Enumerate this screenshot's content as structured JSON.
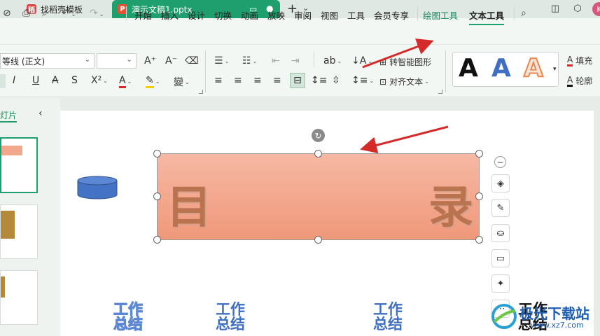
{
  "tabs": [
    {
      "label": "找稻壳模板",
      "icon": "docer-icon"
    },
    {
      "label": "演示文稿1.pptx",
      "icon": "ppt-icon"
    }
  ],
  "tab_controls": {
    "add": "+",
    "menu": "⌄"
  },
  "quick_access": [
    "folder-open",
    "print",
    "print-preview",
    "undo",
    "redo"
  ],
  "menus": [
    {
      "label": "开始"
    },
    {
      "label": "插入"
    },
    {
      "label": "设计"
    },
    {
      "label": "切换"
    },
    {
      "label": "动画"
    },
    {
      "label": "放映"
    },
    {
      "label": "审阅"
    },
    {
      "label": "视图"
    },
    {
      "label": "工具"
    },
    {
      "label": "会员专享"
    },
    {
      "label": "绘图工具"
    },
    {
      "label": "文本工具"
    }
  ],
  "font": {
    "name": "等线 (正文)",
    "size": ""
  },
  "toolbar": {
    "smart_shape": "转智能图形",
    "align_text": "对齐文本",
    "fill": "填充",
    "outline": "轮廓"
  },
  "text_styles": [
    "A",
    "A",
    "A"
  ],
  "left_pane": {
    "header": "灯片"
  },
  "slide": {
    "title_left": "目",
    "title_right": "录",
    "wordart": [
      "工作\n总结",
      "工作\n总结",
      "工作\n总结",
      "工作\n总结"
    ]
  },
  "watermark": {
    "title": "极光下载站",
    "url": "www.xz7.com"
  },
  "colors": {
    "accent": "#1f9e6e",
    "textbox_top": "#f6b9a4",
    "textbox_bottom": "#f0987a",
    "arrow": "#d42a2a"
  }
}
